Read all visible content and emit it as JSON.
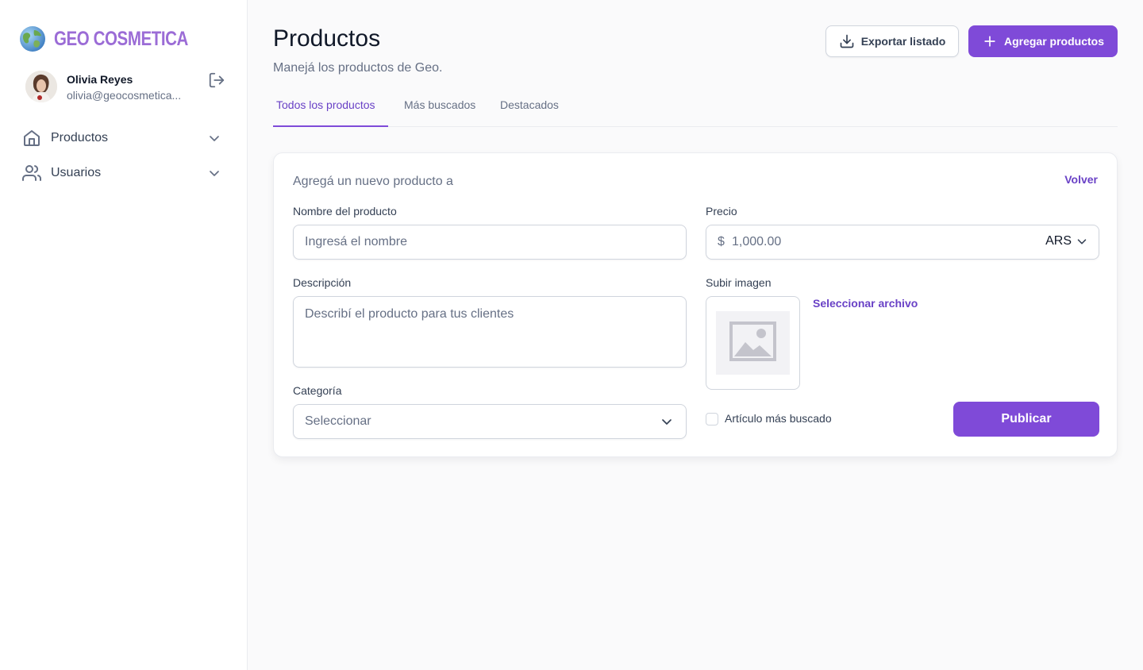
{
  "brand": {
    "name": "GEO COSMETICA",
    "color": "#9b6cd6"
  },
  "user": {
    "name": "Olivia Reyes",
    "email": "olivia@geocosmetica..."
  },
  "sidebar": {
    "items": [
      {
        "label": "Productos",
        "icon": "home-icon"
      },
      {
        "label": "Usuarios",
        "icon": "users-icon"
      }
    ]
  },
  "header": {
    "title": "Productos",
    "subtitle": "Manejá los productos de Geo.",
    "export_label": "Exportar listado",
    "add_label": "Agregar productos"
  },
  "tabs": [
    {
      "label": "Todos los productos",
      "active": true
    },
    {
      "label": "Más buscados",
      "active": false
    },
    {
      "label": "Destacados",
      "active": false
    }
  ],
  "form": {
    "title": "Agregá un nuevo producto a",
    "back_label": "Volver",
    "name_label": "Nombre del producto",
    "name_placeholder": "Ingresá el nombre",
    "price_label": "Precio",
    "price_symbol": "$",
    "price_placeholder": "1,000.00",
    "currency": "ARS",
    "description_label": "Descripción",
    "description_placeholder": "Describí el producto para tus clientes",
    "upload_label": "Subir imagen",
    "select_file_label": "Seleccionar archivo",
    "category_label": "Categoría",
    "category_value": "Seleccionar",
    "featured_checkbox_label": "Artículo más buscado",
    "featured_checked": false,
    "publish_label": "Publicar"
  },
  "colors": {
    "accent": "#7f4ad8",
    "accent_text": "#6941c6"
  }
}
